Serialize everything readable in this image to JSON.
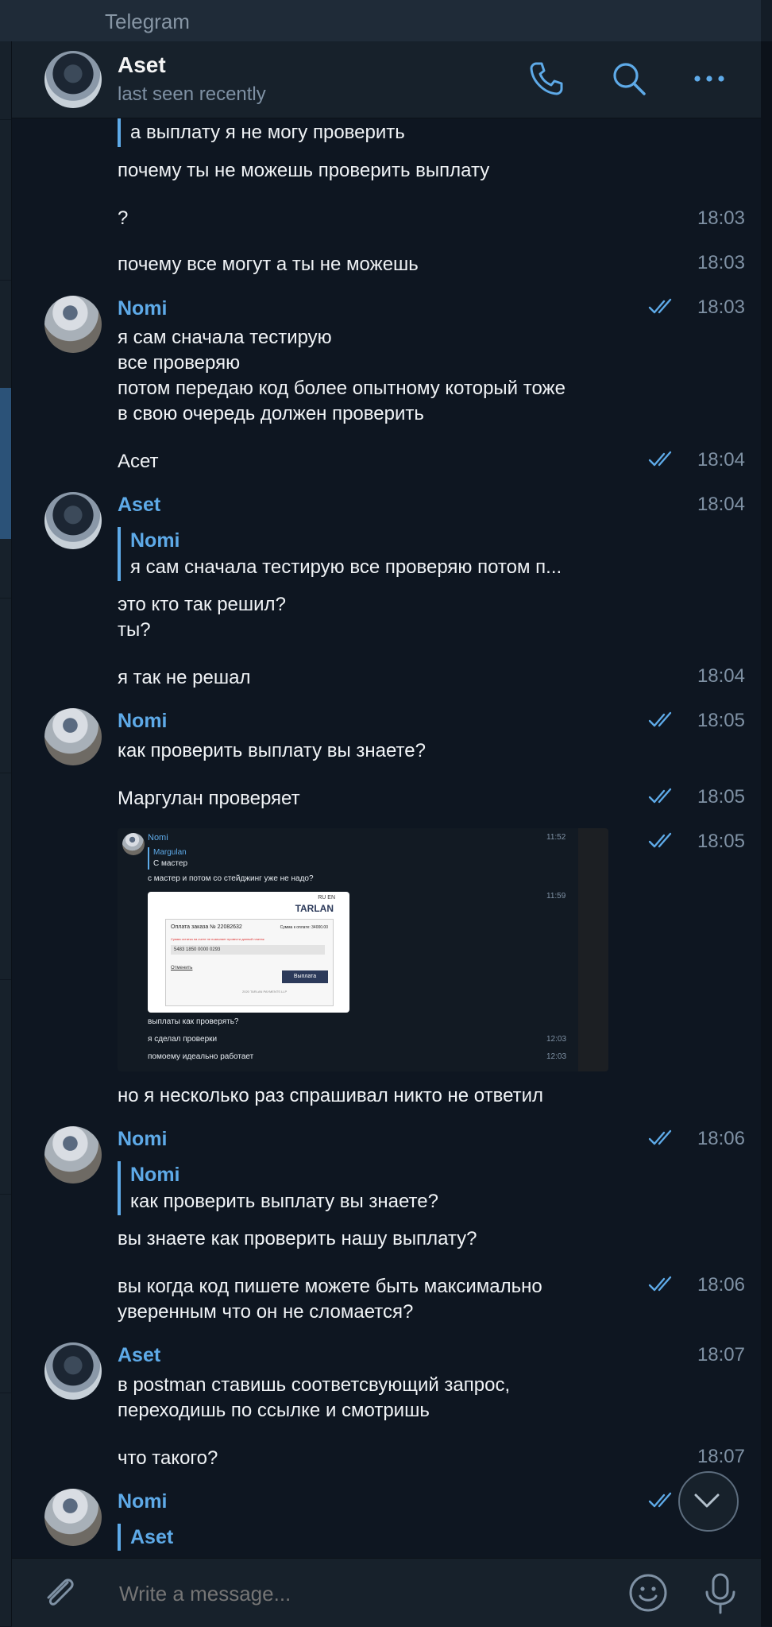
{
  "window": {
    "title": "Telegram"
  },
  "header": {
    "name": "Aset",
    "status": "last seen recently"
  },
  "messages": {
    "m1": {
      "text": "а выплату я не могу проверить"
    },
    "m2": {
      "text": "почему ты не можешь проверить выплату"
    },
    "m3": {
      "text": "?",
      "time": "18:03"
    },
    "m4": {
      "text": "почему все могут а ты не можешь",
      "time": "18:03"
    },
    "m5": {
      "sender": "Nomi",
      "time": "18:03",
      "lines": [
        "я сам сначала тестирую",
        "все проверяю",
        "потом передаю код более опытному который тоже",
        "в свою очередь должен проверить"
      ]
    },
    "m6": {
      "text": "Асет",
      "time": "18:04"
    },
    "m7": {
      "sender": "Aset",
      "time": "18:04",
      "quote_name": "Nomi",
      "quote_text": "я сам сначала тестирую  все проверяю  потом п...",
      "lines": [
        "это кто так решил?",
        "ты?"
      ]
    },
    "m8": {
      "text": "я так не решал",
      "time": "18:04"
    },
    "m9": {
      "sender": "Nomi",
      "time": "18:05",
      "text": "как проверить выплату вы знаете?"
    },
    "m10": {
      "text": "Маргулан проверяет",
      "time": "18:05"
    },
    "m11": {
      "time": "18:05"
    },
    "m12": {
      "text": "но я несколько раз спрашивал никто не ответил"
    },
    "m13": {
      "sender": "Nomi",
      "time": "18:06",
      "quote_name": "Nomi",
      "quote_text": "как проверить выплату вы знаете?",
      "text": "вы знаете как проверить нашу выплату?"
    },
    "m14": {
      "time": "18:06",
      "lines": [
        "вы когда код пишете можете быть максимально",
        "уверенным что он не сломается?"
      ]
    },
    "m15": {
      "sender": "Aset",
      "time": "18:07",
      "lines": [
        "в postman ставишь соответсвующий запрос,",
        "переходишь по ссылке и смотришь"
      ]
    },
    "m16": {
      "text": "что такого?",
      "time": "18:07"
    },
    "m17": {
      "sender": "Nomi",
      "quote_name": "Aset"
    }
  },
  "screenshot": {
    "sender": "Nomi",
    "time1": "11:52",
    "quote_name": "Margulan",
    "quote_text": "С мастер",
    "text1": "с мастер и потом со стейджинг уже не надо?",
    "time2": "11:59",
    "lang": "RU  EN",
    "brand": "TARLAN",
    "order": "Оплата заказа № 22082632",
    "sum": "Сумма к оплате: 34000.00",
    "error": "Сумма остатка на счете не позволяет провести данный платеж",
    "card": "5483 1850 0000 0293",
    "cancel": "Отменить",
    "pay": "Выплата",
    "footer": "2020 TARLAN PAYMENTS LLP",
    "text2": "выплаты как проверять?",
    "text3": "я сделал проверки",
    "time3": "12:03",
    "text4": "помоему идеально работает",
    "time4": "12:03"
  },
  "composer": {
    "placeholder": "Write a message..."
  }
}
